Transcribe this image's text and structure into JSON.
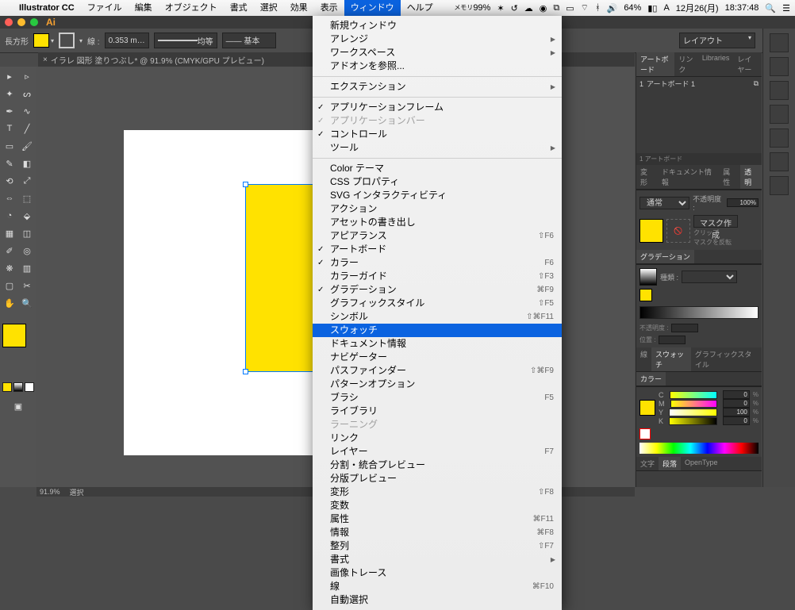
{
  "menubar": {
    "app": "Illustrator CC",
    "items": [
      "ファイル",
      "編集",
      "オブジェクト",
      "書式",
      "選択",
      "効果",
      "表示",
      "ウィンドウ",
      "ヘルプ"
    ],
    "open_index": 7,
    "status": {
      "memory_label": "メモリ",
      "memory_pct": "99%",
      "battery": "64%",
      "date": "12月26(月)",
      "time": "18:37:48"
    }
  },
  "toolbar": {
    "shape": "長方形",
    "stroke_label": "線 :",
    "stroke_w": "0.353 m…",
    "uniform": "均等",
    "basic": "基本",
    "layout": "レイアウト"
  },
  "doc_tab": "イラレ 図形 塗りつぶし* @ 91.9% (CMYK/GPU プレビュー)",
  "status_bar": {
    "zoom": "91.9%",
    "mode": "選択"
  },
  "window_menu": [
    {
      "t": "新規ウィンドウ"
    },
    {
      "t": "アレンジ",
      "arrow": true
    },
    {
      "t": "ワークスペース",
      "arrow": true
    },
    {
      "t": "アドオンを参照..."
    },
    {
      "sep": true
    },
    {
      "t": "エクステンション",
      "arrow": true
    },
    {
      "sep": true
    },
    {
      "t": "アプリケーションフレーム",
      "chk": true
    },
    {
      "t": "アプリケーションバー",
      "chk": true,
      "dim": true
    },
    {
      "t": "コントロール",
      "chk": true
    },
    {
      "t": "ツール",
      "arrow": true
    },
    {
      "sep": true
    },
    {
      "t": "Color テーマ"
    },
    {
      "t": "CSS プロパティ"
    },
    {
      "t": "SVG インタラクティビティ"
    },
    {
      "t": "アクション"
    },
    {
      "t": "アセットの書き出し"
    },
    {
      "t": "アピアランス",
      "sc": "⇧F6"
    },
    {
      "t": "アートボード",
      "chk": true
    },
    {
      "t": "カラー",
      "chk": true,
      "sc": "F6"
    },
    {
      "t": "カラーガイド",
      "sc": "⇧F3"
    },
    {
      "t": "グラデーション",
      "chk": true,
      "sc": "⌘F9"
    },
    {
      "t": "グラフィックスタイル",
      "sc": "⇧F5"
    },
    {
      "t": "シンボル",
      "sc": "⇧⌘F11"
    },
    {
      "t": "スウォッチ",
      "hl": true
    },
    {
      "t": "ドキュメント情報"
    },
    {
      "t": "ナビゲーター"
    },
    {
      "t": "パスファインダー",
      "sc": "⇧⌘F9"
    },
    {
      "t": "パターンオプション"
    },
    {
      "t": "ブラシ",
      "sc": "F5"
    },
    {
      "t": "ライブラリ"
    },
    {
      "t": "ラーニング",
      "dim": true
    },
    {
      "t": "リンク"
    },
    {
      "t": "レイヤー",
      "sc": "F7"
    },
    {
      "t": "分割・統合プレビュー"
    },
    {
      "t": "分版プレビュー"
    },
    {
      "t": "変形",
      "sc": "⇧F8"
    },
    {
      "t": "変数"
    },
    {
      "t": "属性",
      "sc": "⌘F11"
    },
    {
      "t": "情報",
      "sc": "⌘F8"
    },
    {
      "t": "整列",
      "sc": "⇧F7"
    },
    {
      "t": "書式",
      "arrow": true
    },
    {
      "t": "画像トレース"
    },
    {
      "t": "線",
      "sc": "⌘F10"
    },
    {
      "t": "自動選択"
    }
  ],
  "panels": {
    "top_tabs": [
      "アートボード",
      "リンク",
      "Libraries",
      "レイヤー"
    ],
    "artboard_row": {
      "num": "1",
      "name": "アートボード 1"
    },
    "artboard_count": "1 アートボード",
    "tab2": [
      "変形",
      "ドキュメント情報",
      "属性",
      "透明"
    ],
    "blend": "通常",
    "opacity_label": "不透明度 :",
    "opacity": "100%",
    "mask_btn": "マスク作成",
    "clip": "クリップ",
    "invert": "マスクを反転",
    "grad_title": "グラデーション",
    "grad_type_label": "種類 :",
    "opacity2_label": "不透明度 :",
    "pos_label": "位置 :",
    "tab3": [
      "線",
      "スウォッチ",
      "グラフィックスタイル"
    ],
    "color_title": "カラー",
    "cmyk": [
      {
        "l": "C",
        "v": "0"
      },
      {
        "l": "M",
        "v": "0"
      },
      {
        "l": "Y",
        "v": "100"
      },
      {
        "l": "K",
        "v": "0"
      }
    ],
    "pct": "%",
    "tab4": [
      "文字",
      "段落",
      "OpenType"
    ]
  }
}
